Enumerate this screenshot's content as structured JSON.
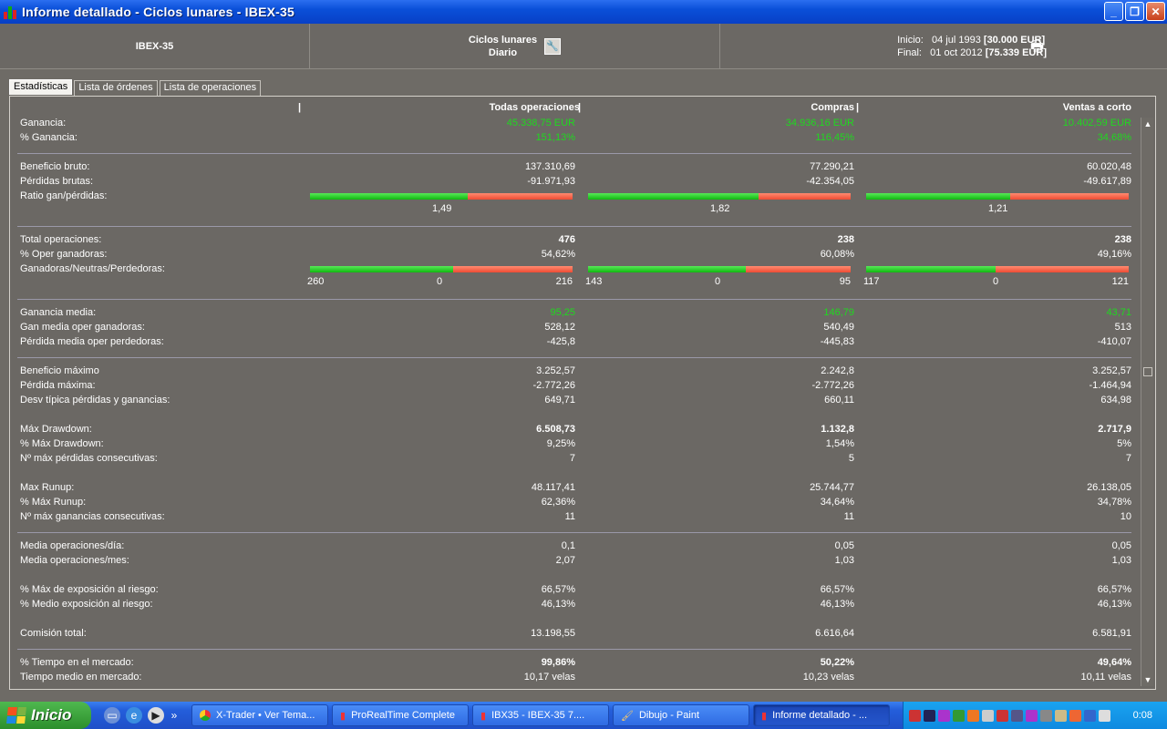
{
  "window": {
    "title": "Informe detallado - Ciclos lunares - IBEX-35"
  },
  "header": {
    "instrument": "IBEX-35",
    "system_name": "Ciclos lunares",
    "period": "Diario",
    "start_label": "Inicio:",
    "start_date": "04 jul 1993",
    "start_value": "[30.000 EUR]",
    "end_label": "Final:",
    "end_date": "01 oct 2012",
    "end_value": "[75.339 EUR]"
  },
  "tabs": [
    "Estadísticas",
    "Lista de órdenes",
    "Lista de operaciones"
  ],
  "columns": [
    "Todas operaciones",
    "Compras",
    "Ventas a corto"
  ],
  "rows": {
    "ganancia": {
      "label": "Ganancia:",
      "v": [
        "45.338,75 EUR",
        "34.936,16 EUR",
        "10.402,59 EUR"
      ]
    },
    "pct_ganancia": {
      "label": "% Ganancia:",
      "v": [
        "151,13%",
        "116,45%",
        "34,68%"
      ]
    },
    "beneficio_bruto": {
      "label": "Beneficio bruto:",
      "v": [
        "137.310,69",
        "77.290,21",
        "60.020,48"
      ]
    },
    "perdidas_brutas": {
      "label": "Pérdidas brutas:",
      "v": [
        "-91.971,93",
        "-42.354,05",
        "-49.617,89"
      ]
    },
    "ratio": {
      "label": "Ratio gan/pérdidas:",
      "v": [
        "1,49",
        "1,82",
        "1,21"
      ],
      "green_fraction": [
        0.6,
        0.65,
        0.55
      ]
    },
    "total_ops": {
      "label": "Total operaciones:",
      "v": [
        "476",
        "238",
        "238"
      ]
    },
    "pct_oper_ganadoras": {
      "label": "% Oper ganadoras:",
      "v": [
        "54,62%",
        "60,08%",
        "49,16%"
      ]
    },
    "gnp": {
      "label": "Ganadoras/Neutras/Perdedoras:",
      "wins": [
        "260",
        "143",
        "117"
      ],
      "neutral": [
        "0",
        "0",
        "0"
      ],
      "losses": [
        "216",
        "95",
        "121"
      ],
      "green_fraction": [
        0.5462,
        0.6008,
        0.4916
      ]
    },
    "ganancia_media": {
      "label": "Ganancia media:",
      "v": [
        "95,25",
        "146,79",
        "43,71"
      ]
    },
    "gan_media_ganadoras": {
      "label": "Gan media oper ganadoras:",
      "v": [
        "528,12",
        "540,49",
        "513"
      ]
    },
    "perd_media_perdedoras": {
      "label": "Pérdida media oper perdedoras:",
      "v": [
        "-425,8",
        "-445,83",
        "-410,07"
      ]
    },
    "beneficio_maximo": {
      "label": "Beneficio máximo",
      "v": [
        "3.252,57",
        "2.242,8",
        "3.252,57"
      ]
    },
    "perdida_maxima": {
      "label": "Pérdida máxima:",
      "v": [
        "-2.772,26",
        "-2.772,26",
        "-1.464,94"
      ]
    },
    "desv_tipica": {
      "label": "Desv típica pérdidas y ganancias:",
      "v": [
        "649,71",
        "660,11",
        "634,98"
      ]
    },
    "max_drawdown": {
      "label": "Máx Drawdown:",
      "v": [
        "6.508,73",
        "1.132,8",
        "2.717,9"
      ]
    },
    "pct_max_drawdown": {
      "label": "% Máx Drawdown:",
      "v": [
        "9,25%",
        "1,54%",
        "5%"
      ]
    },
    "max_perdidas_consec": {
      "label": "Nº máx pérdidas consecutivas:",
      "v": [
        "7",
        "5",
        "7"
      ]
    },
    "max_runup": {
      "label": "Max Runup:",
      "v": [
        "48.117,41",
        "25.744,77",
        "26.138,05"
      ]
    },
    "pct_max_runup": {
      "label": "% Máx Runup:",
      "v": [
        "62,36%",
        "34,64%",
        "34,78%"
      ]
    },
    "max_ganancias_consec": {
      "label": "Nº máx ganancias consecutivas:",
      "v": [
        "11",
        "11",
        "10"
      ]
    },
    "media_ops_dia": {
      "label": "Media operaciones/día:",
      "v": [
        "0,1",
        "0,05",
        "0,05"
      ]
    },
    "media_ops_mes": {
      "label": "Media operaciones/mes:",
      "v": [
        "2,07",
        "1,03",
        "1,03"
      ]
    },
    "max_exposicion": {
      "label": "% Máx de exposición al riesgo:",
      "v": [
        "66,57%",
        "66,57%",
        "66,57%"
      ]
    },
    "medio_exposicion": {
      "label": "% Medio exposición al riesgo:",
      "v": [
        "46,13%",
        "46,13%",
        "46,13%"
      ]
    },
    "comision_total": {
      "label": "Comisión total:",
      "v": [
        "13.198,55",
        "6.616,64",
        "6.581,91"
      ]
    },
    "pct_tiempo_mercado": {
      "label": "% Tiempo en el mercado:",
      "v": [
        "99,86%",
        "50,22%",
        "49,64%"
      ]
    },
    "tiempo_medio_mercado": {
      "label": "Tiempo medio en mercado:",
      "v": [
        "10,17 velas",
        "10,23 velas",
        "10,11 velas"
      ]
    }
  },
  "taskbar": {
    "start_label": "Inicio",
    "tasks": [
      "X-Trader • Ver Tema...",
      "ProRealTime Complete",
      "IBX35 - IBEX-35   7....",
      "Dibujo - Paint",
      "Informe detallado - ..."
    ],
    "clock": "0:08"
  },
  "colors": {
    "positive": "#1fd91f",
    "bar_green": "#10b810",
    "bar_red": "#ee4c34",
    "titlebar": "#0a4fd8"
  }
}
